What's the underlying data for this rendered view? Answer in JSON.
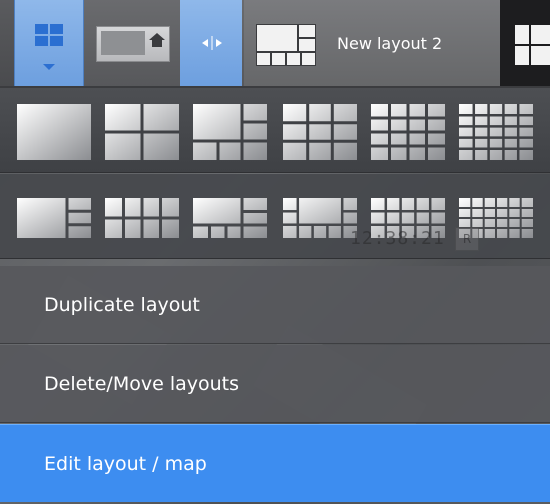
{
  "topbar": {
    "layout_button": {
      "icon": "layouts-grid-icon"
    },
    "mini_tab": {
      "icon": "home-icon"
    },
    "splitter": {
      "icon": "resize-arrows-icon"
    },
    "active_tab": {
      "title": "New layout 2"
    }
  },
  "menu": {
    "thumbnails_row1": [
      "1",
      "2x2",
      "1+5",
      "3x3",
      "4x4",
      "5x5"
    ],
    "thumbnails_row2": [
      "1+3",
      "2x4",
      "1+7",
      "1+12",
      "3x5",
      "4x6"
    ],
    "overlay_time": "12:38:21",
    "overlay_tag": "R",
    "items": [
      {
        "label": "Duplicate layout"
      },
      {
        "label": "Delete/Move layouts"
      },
      {
        "label": "Edit layout / map"
      }
    ],
    "highlight_color": "#3d8df0"
  }
}
